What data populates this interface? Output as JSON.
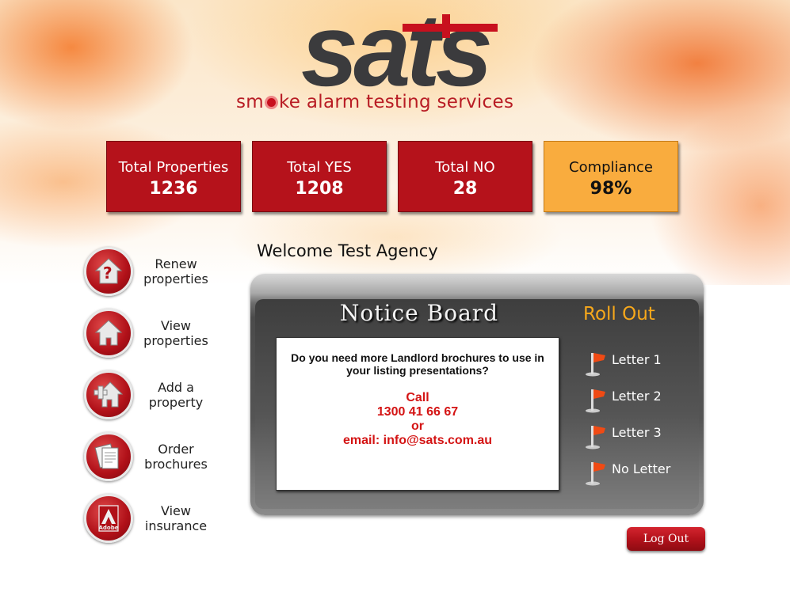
{
  "header": {
    "logo_text": "sats",
    "tagline_pre": "sm",
    "tagline_post": "ke alarm testing services"
  },
  "stats": [
    {
      "label": "Total Properties",
      "value": "1236"
    },
    {
      "label": "Total YES",
      "value": "1208"
    },
    {
      "label": "Total NO",
      "value": "28"
    },
    {
      "label": "Compliance",
      "value": "98%"
    }
  ],
  "welcome": "Welcome Test Agency",
  "sidebar": {
    "items": [
      {
        "label": "Renew properties",
        "icon": "house-question-icon"
      },
      {
        "label": "View properties",
        "icon": "house-icon"
      },
      {
        "label": "Add a property",
        "icon": "house-plus-icon"
      },
      {
        "label": "Order brochures",
        "icon": "brochure-icon"
      },
      {
        "label": "View insurance",
        "icon": "adobe-icon",
        "icon_text": "Adobe"
      }
    ]
  },
  "notice_board": {
    "title": "Notice Board",
    "question": "Do you need more Landlord brochures to use in your listing presentations?",
    "call": "Call",
    "phone": "1300 41 66 67",
    "or": "or",
    "email": "email: info@sats.com.au"
  },
  "rollout": {
    "title": "Roll Out",
    "items": [
      "Letter 1",
      "Letter 2",
      "Letter 3",
      "No Letter"
    ]
  },
  "logout_label": "Log Out",
  "colors": {
    "brand_red": "#b5121b",
    "compliance_orange": "#f9ac3e",
    "rollout_title": "#f7a81b",
    "notice_red": "#d41414"
  }
}
